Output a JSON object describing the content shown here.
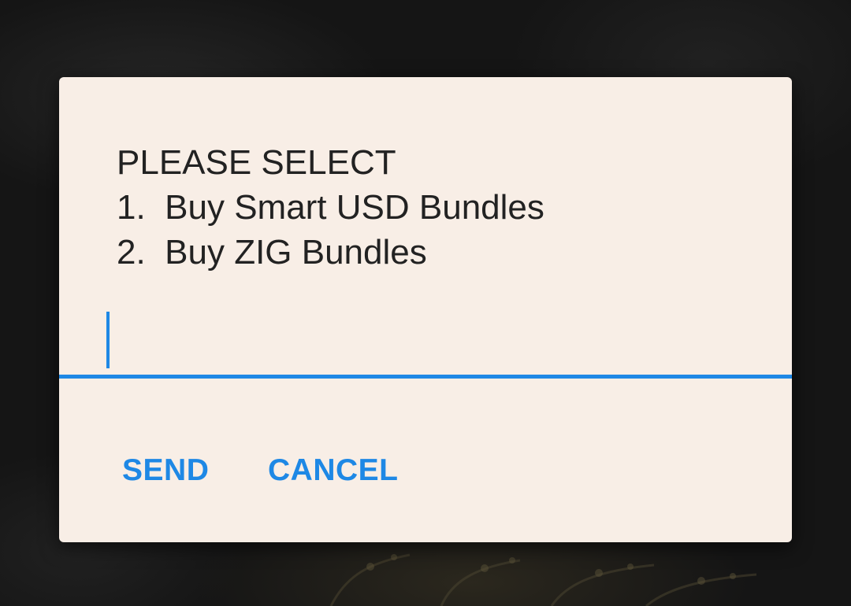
{
  "dialog": {
    "message_lines": [
      "PLEASE SELECT",
      "1.  Buy Smart USD Bundles",
      "2.  Buy ZIG Bundles"
    ],
    "input": {
      "value": "",
      "placeholder": ""
    },
    "buttons": {
      "send_label": "SEND",
      "cancel_label": "CANCEL"
    }
  },
  "colors": {
    "dialog_background": "#f8eee6",
    "accent": "#1e88e5",
    "text": "#222222",
    "backdrop": "#151515"
  }
}
